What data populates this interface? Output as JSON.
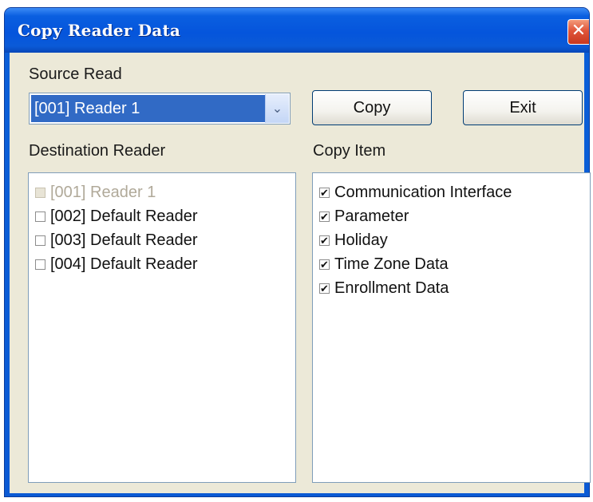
{
  "window": {
    "title": "Copy Reader Data",
    "close_glyph": "✕"
  },
  "source": {
    "label": "Source Read",
    "selected": "[001] Reader 1",
    "arrow_glyph": "⌄"
  },
  "buttons": {
    "copy": "Copy",
    "exit": "Exit"
  },
  "destination": {
    "label": "Destination Reader",
    "items": [
      {
        "label": "[001] Reader 1",
        "checked": false,
        "disabled": true
      },
      {
        "label": "[002] Default Reader",
        "checked": false,
        "disabled": false
      },
      {
        "label": "[003] Default Reader",
        "checked": false,
        "disabled": false
      },
      {
        "label": "[004] Default Reader",
        "checked": false,
        "disabled": false
      }
    ]
  },
  "copy_items": {
    "label": "Copy Item",
    "items": [
      {
        "label": "Communication Interface",
        "checked": true
      },
      {
        "label": "Parameter",
        "checked": true
      },
      {
        "label": "Holiday",
        "checked": true
      },
      {
        "label": "Time Zone Data",
        "checked": true
      },
      {
        "label": "Enrollment Data",
        "checked": true
      }
    ]
  },
  "colors": {
    "titlebar": "#0555dc",
    "selection": "#316ac5",
    "dialog_bg": "#ece9d8",
    "close_button": "#e0553a"
  }
}
